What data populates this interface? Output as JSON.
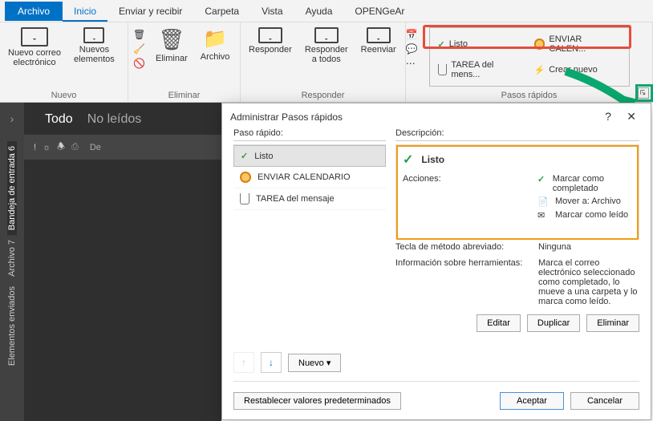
{
  "menubar": [
    "Archivo",
    "Inicio",
    "Enviar y recibir",
    "Carpeta",
    "Vista",
    "Ayuda",
    "OPENGeAr"
  ],
  "menubar_active_index": 1,
  "ribbon": {
    "groups": {
      "nuevo": {
        "label": "Nuevo",
        "new_mail": "Nuevo correo\nelectrónico",
        "new_items": "Nuevos\nelementos"
      },
      "eliminar": {
        "label": "Eliminar",
        "delete": "Eliminar",
        "archive": "Archivo"
      },
      "responder": {
        "label": "Responder",
        "reply": "Responder",
        "reply_all": "Responder\na todos",
        "forward": "Reenviar"
      },
      "quicksteps": {
        "label": "Pasos rápidos",
        "items": [
          {
            "name": "Listo",
            "icon": "check"
          },
          {
            "name": "ENVIAR CALEN...",
            "icon": "clock"
          },
          {
            "name": "TAREA del mens...",
            "icon": "clip"
          },
          {
            "name": "Crear nuevo",
            "icon": "bolt"
          }
        ]
      }
    }
  },
  "sidebar": {
    "tabs": [
      "Bandeja de entrada 6",
      "Archivo 7",
      "Elementos enviados"
    ],
    "active_index": 0
  },
  "mailpane": {
    "filters": [
      "Todo",
      "No leídos"
    ],
    "selected_filter": 0,
    "header_from": "De"
  },
  "dialog": {
    "title": "Administrar Pasos rápidos",
    "left_label": "Paso rápido:",
    "right_label": "Descripción:",
    "steps": [
      {
        "name": "Listo",
        "icon": "check"
      },
      {
        "name": "ENVIAR CALENDARIO",
        "icon": "clock"
      },
      {
        "name": "TAREA del mensaje",
        "icon": "clip"
      }
    ],
    "selected_step_index": 0,
    "desc": {
      "title": "Listo",
      "actions_label": "Acciones:",
      "actions": [
        {
          "icon": "check",
          "text": "Marcar como completado"
        },
        {
          "icon": "move",
          "text": "Mover a: Archivo"
        },
        {
          "icon": "envelope",
          "text": "Marcar como leído"
        }
      ],
      "shortcut_label": "Tecla de método abreviado:",
      "shortcut_value": "Ninguna",
      "tooltip_label": "Información sobre herramientas:",
      "tooltip_value": "Marca el correo electrónico seleccionado como completado, lo mueve a una carpeta y lo marca como leído."
    },
    "buttons": {
      "edit": "Editar",
      "duplicate": "Duplicar",
      "delete": "Eliminar",
      "new": "Nuevo",
      "reset": "Restablecer valores predeterminados",
      "ok": "Aceptar",
      "cancel": "Cancelar"
    }
  }
}
